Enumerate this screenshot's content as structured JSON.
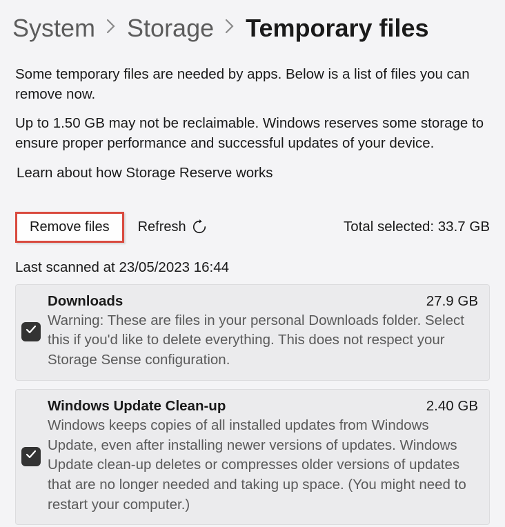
{
  "breadcrumb": {
    "items": [
      "System",
      "Storage",
      "Temporary files"
    ]
  },
  "description1": "Some temporary files are needed by apps. Below is a list of files you can remove now.",
  "description2": "Up to 1.50 GB may not be reclaimable. Windows reserves some storage to ensure proper performance and successful updates of your device.",
  "learn_link": "Learn about how Storage Reserve works",
  "actions": {
    "remove_label": "Remove files",
    "refresh_label": "Refresh",
    "total_prefix": "Total selected: ",
    "total_value": "33.7 GB"
  },
  "last_scanned_prefix": "Last scanned at ",
  "last_scanned_value": "23/05/2023 16:44",
  "items": [
    {
      "title": "Downloads",
      "size": "27.9 GB",
      "description": "Warning: These are files in your personal Downloads folder. Select this if you'd like to delete everything. This does not respect your Storage Sense configuration.",
      "checked": true
    },
    {
      "title": "Windows Update Clean-up",
      "size": "2.40 GB",
      "description": "Windows keeps copies of all installed updates from Windows Update, even after installing newer versions of updates. Windows Update clean-up deletes or compresses older versions of updates that are no longer needed and taking up space. (You might need to restart your computer.)",
      "checked": true
    }
  ]
}
